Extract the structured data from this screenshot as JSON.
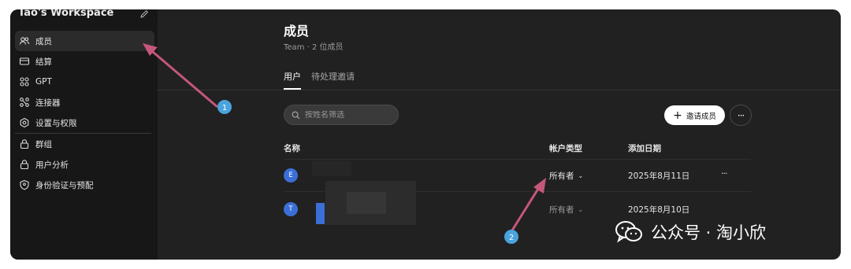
{
  "sidebar": {
    "workspace_title": "Tao's Workspace",
    "items": [
      {
        "label": "成员",
        "icon": "users-icon",
        "active": true
      },
      {
        "label": "结算",
        "icon": "card-icon"
      },
      {
        "label": "GPT",
        "icon": "grid-icon"
      },
      {
        "label": "连接器",
        "icon": "connector-icon"
      },
      {
        "label": "设置与权限",
        "icon": "gear-icon"
      },
      {
        "label": "群组",
        "icon": "lock-icon"
      },
      {
        "label": "用户分析",
        "icon": "lock-icon"
      },
      {
        "label": "身份验证与预配",
        "icon": "shield-icon"
      }
    ]
  },
  "header": {
    "title": "成员",
    "subtitle": "Team · 2 位成员"
  },
  "tabs": [
    {
      "label": "用户",
      "active": true
    },
    {
      "label": "待处理邀请"
    }
  ],
  "search": {
    "placeholder": "按姓名筛选"
  },
  "invite_button": "邀请成员",
  "more_button": "···",
  "table": {
    "columns": [
      "名称",
      "帐户类型",
      "添加日期"
    ],
    "rows": [
      {
        "avatar": "E",
        "role": "所有者",
        "date": "2025年8月11日",
        "more": "···"
      },
      {
        "avatar": "T",
        "role": "所有者",
        "date": "2025年8月10日"
      }
    ]
  },
  "annotations": [
    "1",
    "2"
  ],
  "watermark": "公众号 · 淘小欣",
  "colors": {
    "accent": "#3b6fd6",
    "arrow": "#c4577a",
    "badge": "#4aa3dc"
  }
}
